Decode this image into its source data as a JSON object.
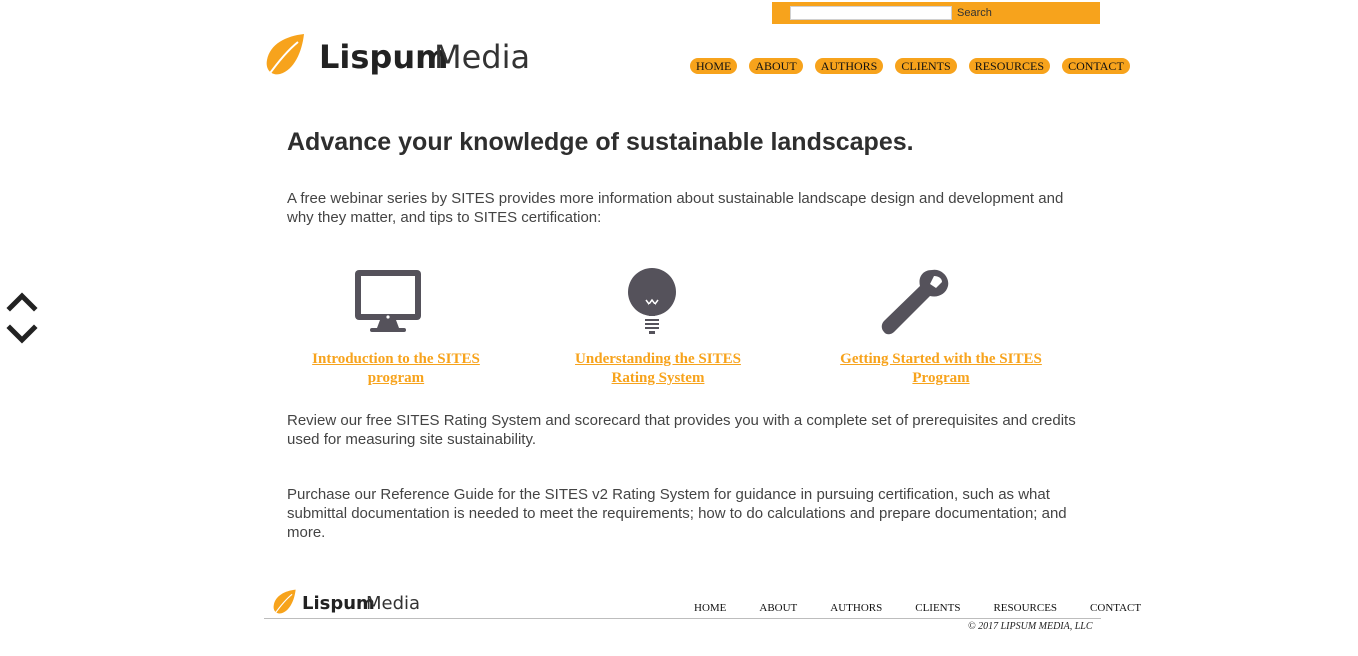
{
  "search": {
    "placeholder": "",
    "value": "",
    "button_label": "Search"
  },
  "brand": {
    "name_bold": "Lispum",
    "name_light": "Media"
  },
  "nav": {
    "items": [
      {
        "label": "HOME"
      },
      {
        "label": "ABOUT"
      },
      {
        "label": "AUTHORS"
      },
      {
        "label": "CLIENTS"
      },
      {
        "label": "RESOURCES"
      },
      {
        "label": "CONTACT"
      }
    ]
  },
  "main": {
    "headline": "Advance your knowledge of sustainable landscapes.",
    "intro": "A free webinar series by SITES provides more information about sustainable landscape design and development and why they matter, and tips to SITES certification:",
    "features": [
      {
        "icon": "monitor-icon",
        "link": "Introduction to the SITES program"
      },
      {
        "icon": "lightbulb-icon",
        "link": "Understanding the SITES Rating System"
      },
      {
        "icon": "wrench-icon",
        "link": "Getting Started with the SITES Program"
      }
    ],
    "review": "Review our free SITES Rating System and scorecard that provides you with a complete set of prerequisites and credits used for measuring site sustainability.",
    "purchase": "Purchase our Reference Guide for the SITES v2 Rating System for guidance in pursuing certification, such as what submittal documentation is needed to meet the requirements; how to do calculations and prepare documentation; and more."
  },
  "footer": {
    "links": [
      "HOME",
      "ABOUT",
      "AUTHORS",
      "CLIENTS",
      "RESOURCES",
      "CONTACT"
    ],
    "copyright": "© 2017 LIPSUM MEDIA, LLC"
  },
  "colors": {
    "accent": "#f7a31c",
    "icon": "#55525b",
    "text": "#444444"
  }
}
